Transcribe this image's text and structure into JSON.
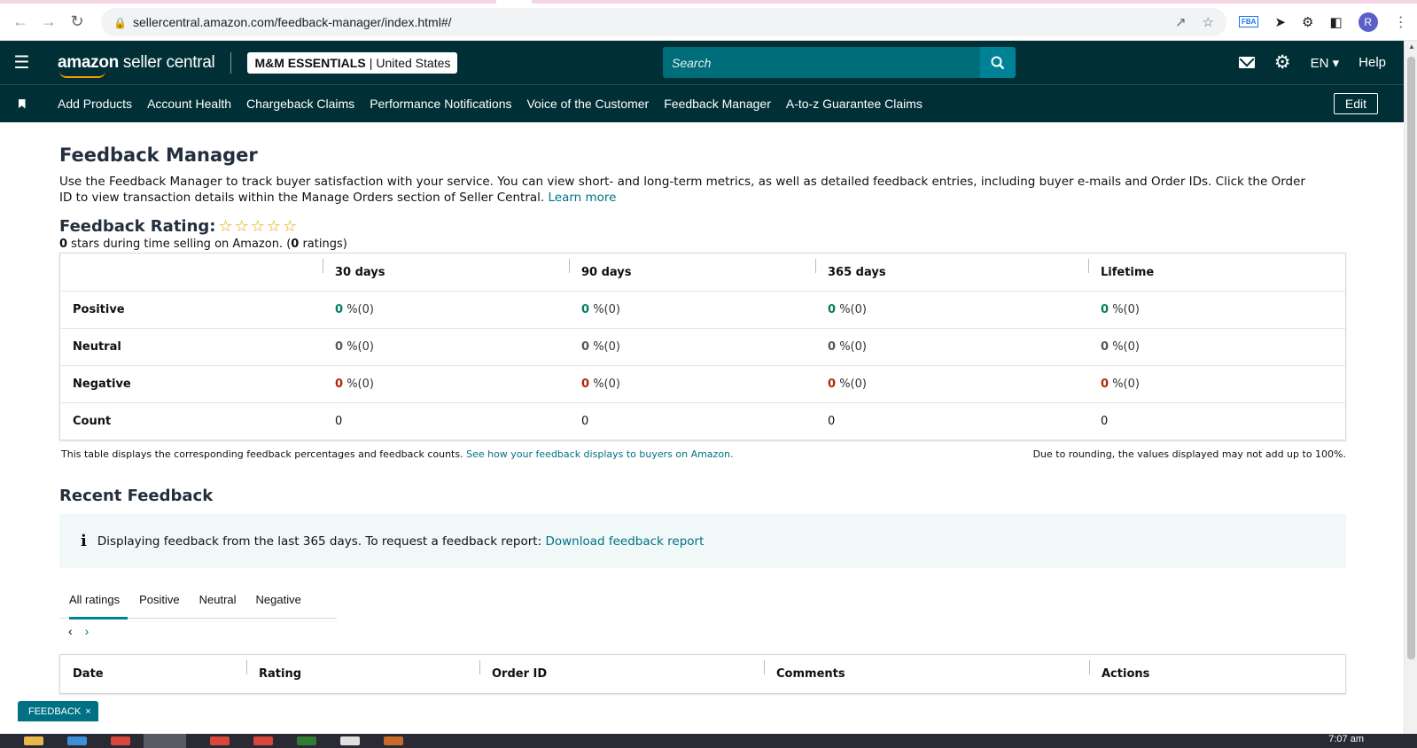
{
  "browser": {
    "url": "sellercentral.amazon.com/feedback-manager/index.html#/",
    "profile_initial": "R",
    "fba_label": "FBA"
  },
  "header": {
    "logo_brand": "amazon",
    "logo_text": " seller central",
    "store_name": "M&M ESSENTIALS",
    "store_sep": "|",
    "store_region": "United States",
    "search_placeholder": "Search",
    "language": "EN",
    "help": "Help"
  },
  "nav": {
    "items": [
      "Add Products",
      "Account Health",
      "Chargeback Claims",
      "Performance Notifications",
      "Voice of the Customer",
      "Feedback Manager",
      "A-to-z Guarantee Claims"
    ],
    "edit": "Edit"
  },
  "main": {
    "title": "Feedback Manager",
    "intro": "Use the Feedback Manager to track buyer satisfaction with your service. You can view short- and long-term metrics, as well as detailed feedback entries, including buyer e-mails and Order IDs. Click the Order ID to view transaction details within the Manage Orders section of Seller Central.",
    "learn_more": "Learn more",
    "rating_title": "Feedback Rating:",
    "rating_stars": 0,
    "rating_sub_stars": "0",
    "rating_sub_mid": " stars during time selling on Amazon. (",
    "rating_sub_count": "0",
    "rating_sub_end": " ratings)",
    "table": {
      "headers": [
        "",
        "30 days",
        "90 days",
        "365 days",
        "Lifetime"
      ],
      "rows": [
        {
          "label": "Positive",
          "values": [
            "0",
            "0",
            "0",
            "0"
          ],
          "suffix": "%(0)"
        },
        {
          "label": "Neutral",
          "values": [
            "0",
            "0",
            "0",
            "0"
          ],
          "suffix": "%(0)"
        },
        {
          "label": "Negative",
          "values": [
            "0",
            "0",
            "0",
            "0"
          ],
          "suffix": "%(0)"
        },
        {
          "label": "Count",
          "values": [
            "0",
            "0",
            "0",
            "0"
          ]
        }
      ]
    },
    "table_note": "This table displays the corresponding feedback percentages and feedback counts.",
    "table_note_link": "See how your feedback displays to buyers on Amazon.",
    "rounding_note": "Due to rounding, the values displayed may not add up to 100%.",
    "recent_title": "Recent Feedback",
    "info_icon": "i",
    "info_text": "Displaying feedback from the last 365 days. To request a feedback report:",
    "info_link": "Download feedback report",
    "tabs": [
      "All ratings",
      "Positive",
      "Neutral",
      "Negative"
    ],
    "pager_prev": "‹",
    "pager_next": "›",
    "orders_headers": [
      "Date",
      "Rating",
      "Order ID",
      "Comments",
      "Actions"
    ]
  },
  "feedback_tab": {
    "label": "FEEDBACK",
    "close": "×"
  },
  "taskbar": {
    "time": "7:07 am"
  },
  "colors": {
    "header_bg": "#002f36",
    "search_bg": "#006e7a",
    "link": "#007185",
    "positive": "#067d62",
    "negative": "#b12704",
    "star": "#e3a400"
  }
}
